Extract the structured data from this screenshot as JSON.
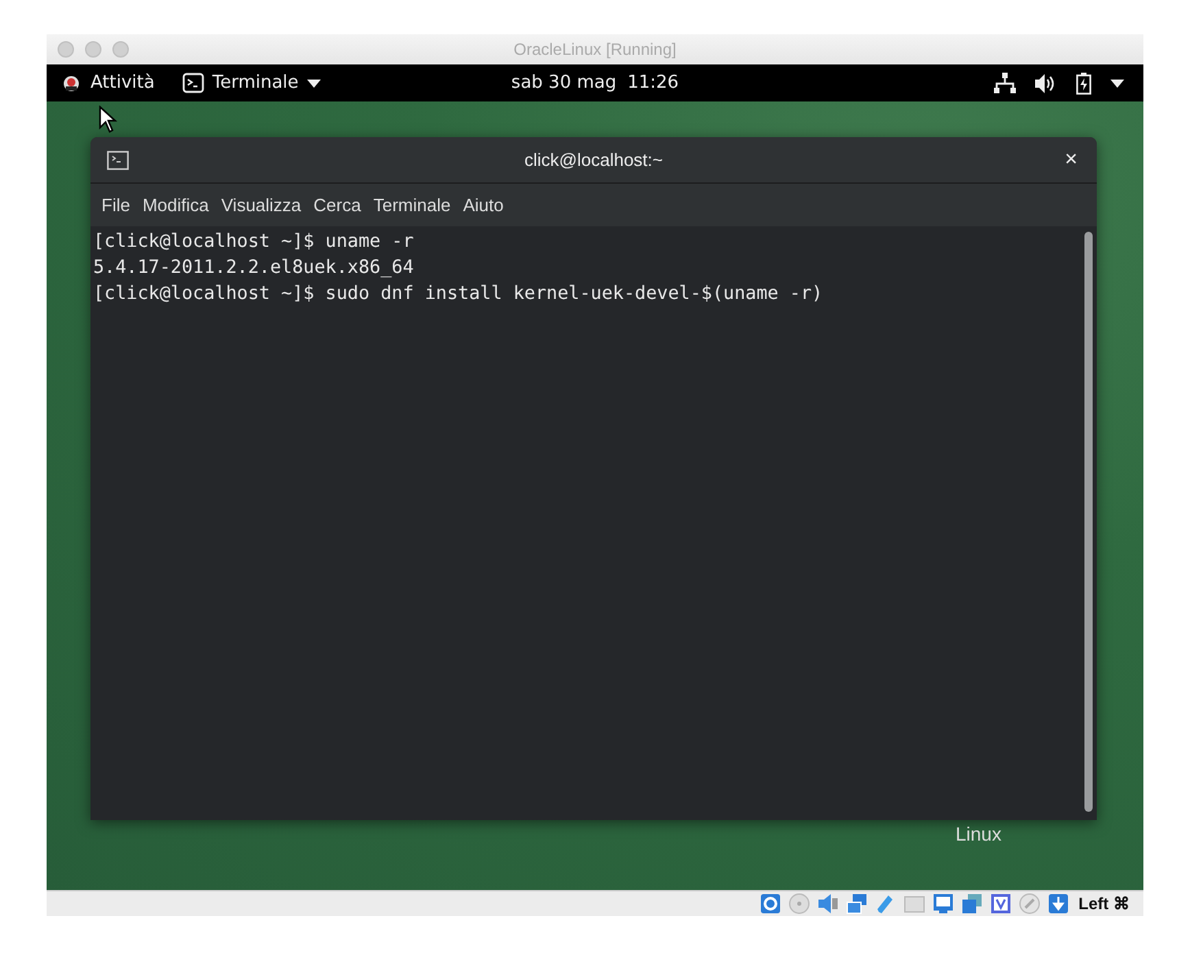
{
  "window": {
    "title": "OracleLinux [Running]"
  },
  "top_bar": {
    "activities": "Attività",
    "app_menu": "Terminale",
    "date": "sab 30 mag",
    "time": "11:26"
  },
  "terminal": {
    "title": "click@localhost:~",
    "close": "×",
    "menu": [
      "File",
      "Modifica",
      "Visualizza",
      "Cerca",
      "Terminale",
      "Aiuto"
    ],
    "lines": [
      "[click@localhost ~]$ uname -r",
      "5.4.17-2011.2.2.el8uek.x86_64",
      "[click@localhost ~]$ sudo dnf install kernel-uek-devel-$(uname -r)"
    ]
  },
  "desktop": {
    "label": "Linux"
  },
  "status_bar": {
    "host_key": "Left ⌘"
  }
}
